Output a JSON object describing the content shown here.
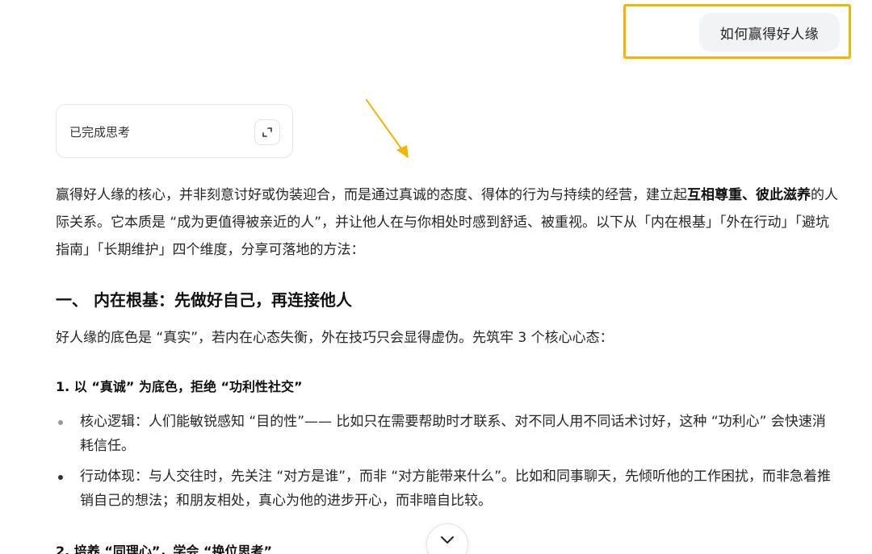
{
  "user_message": {
    "text": "如何赢得好人缘"
  },
  "thinking": {
    "label": "已完成思考",
    "expand_icon": "expand-icon"
  },
  "answer": {
    "intro_part1": "赢得好人缘的核心，并非刻意讨好或伪装迎合，而是通过真诚的态度、得体的行为与持续的经营，建立起",
    "intro_bold": "互相尊重、彼此滋养",
    "intro_part2": "的人际关系。它本质是 “成为更值得被亲近的人”，并让他人在与你相处时感到舒适、被重视。以下从「内在根基」「外在行动」「避坑指南」「长期维护」四个维度，分享可落地的方法：",
    "section1_title": "一、 内在根基：先做好自己，再连接他人",
    "section1_lead": "好人缘的底色是 “真实”，若内在心态失衡，外在技巧只会显得虚伪。先筑牢 3 个核心心态：",
    "point1_title": "1. 以 “真诚” 为底色，拒绝 “功利性社交”",
    "bullets": [
      "核心逻辑：人们能敏锐感知 “目的性”—— 比如只在需要帮助时才联系、对不同人用不同话术讨好，这种 “功利心” 会快速消耗信任。",
      "行动体现：与人交往时，先关注 “对方是谁”，而非 “对方能带来什么”。比如和同事聊天，先倾听他的工作困扰，而非急着推销自己的想法；和朋友相处，真心为他的进步开心，而非暗自比较。"
    ],
    "point2_title": "2. 培养 “同理心”，学会 “换位思考”"
  },
  "annotation": {
    "highlight_color": "#f5b400",
    "arrow_color": "#f5b400"
  },
  "scroll_button": {
    "icon": "chevron-down-icon"
  }
}
